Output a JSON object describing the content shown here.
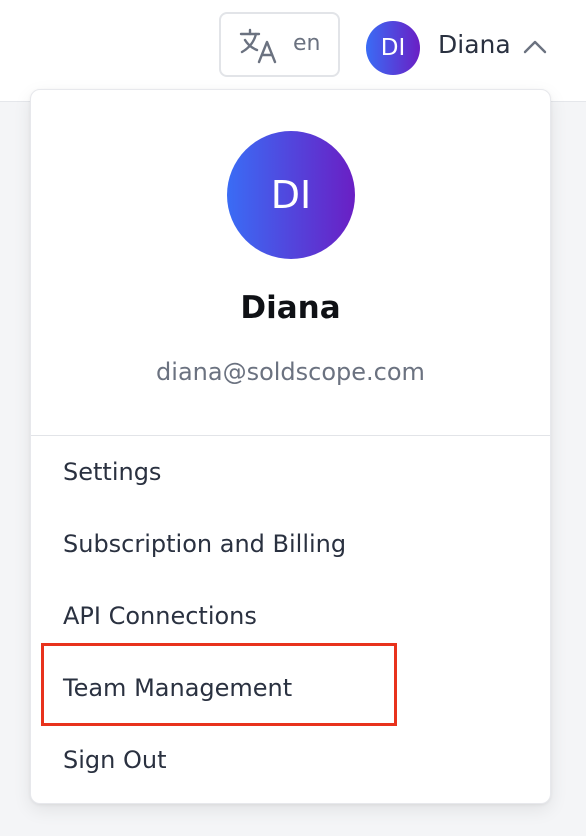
{
  "header": {
    "language": {
      "code": "en",
      "icon": "translate-icon"
    },
    "user": {
      "initials": "DI",
      "name": "Diana",
      "chevron_icon": "chevron-up-icon"
    }
  },
  "dropdown": {
    "profile": {
      "initials": "DI",
      "name": "Diana",
      "email": "diana@soldscope.com"
    },
    "menu": [
      {
        "label": "Settings"
      },
      {
        "label": "Subscription and Billing"
      },
      {
        "label": "API Connections"
      },
      {
        "label": "Team Management"
      },
      {
        "label": "Sign Out"
      }
    ]
  },
  "colors": {
    "avatar_gradient_start": "#3a6cf5",
    "avatar_gradient_end": "#6a1fc4",
    "highlight": "#e8321c"
  }
}
